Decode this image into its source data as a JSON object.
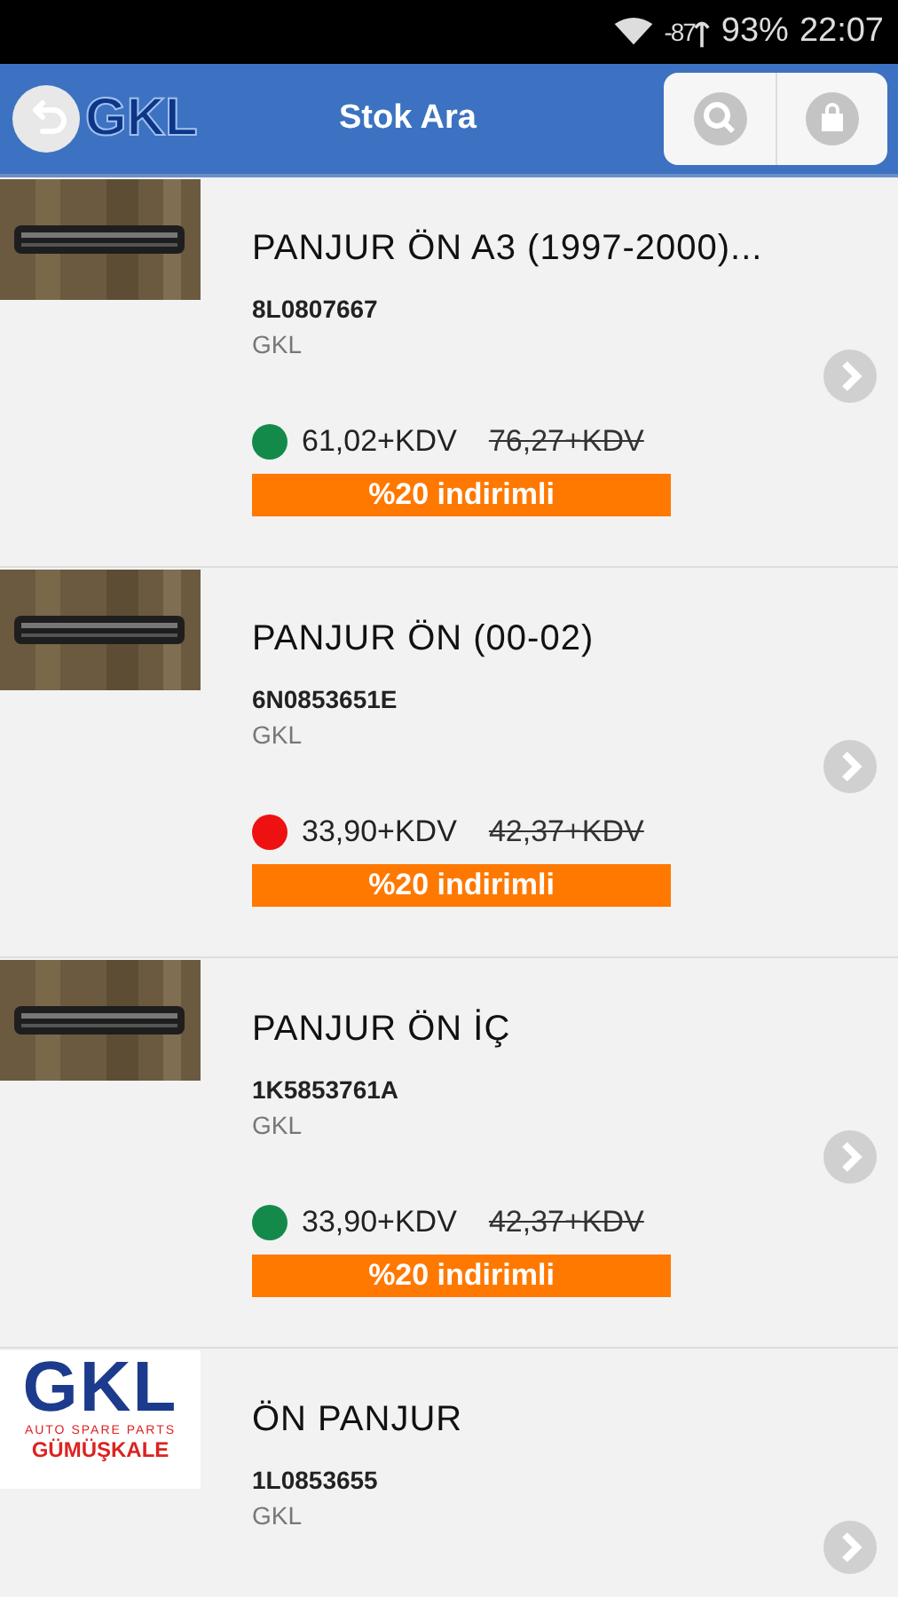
{
  "status_bar": {
    "signal": "-87",
    "battery": "93%",
    "time": "22:07"
  },
  "header": {
    "logo": "GKL",
    "title": "Stok Ara"
  },
  "products": [
    {
      "name": "PANJUR ÖN A3 (1997-2000)...",
      "code": "8L0807667",
      "brand": "GKL",
      "color": "#138a4a",
      "price": "61,02+KDV",
      "old_price": "76,27+KDV",
      "discount": "%20 indirimli"
    },
    {
      "name": "PANJUR ÖN (00-02)",
      "code": "6N0853651E",
      "brand": "GKL",
      "color": "#ee1111",
      "price": "33,90+KDV",
      "old_price": "42,37+KDV",
      "discount": "%20 indirimli"
    },
    {
      "name": "PANJUR ÖN İÇ",
      "code": "1K5853761A",
      "brand": "GKL",
      "color": "#138a4a",
      "price": "33,90+KDV",
      "old_price": "42,37+KDV",
      "discount": "%20 indirimli"
    },
    {
      "kind": "logo",
      "logo": {
        "mark": "GKL",
        "tagline": "AUTO SPARE PARTS",
        "company": "GÜMÜŞKALE"
      },
      "name": "ÖN PANJUR",
      "code": "1L0853655",
      "brand": "GKL"
    }
  ]
}
